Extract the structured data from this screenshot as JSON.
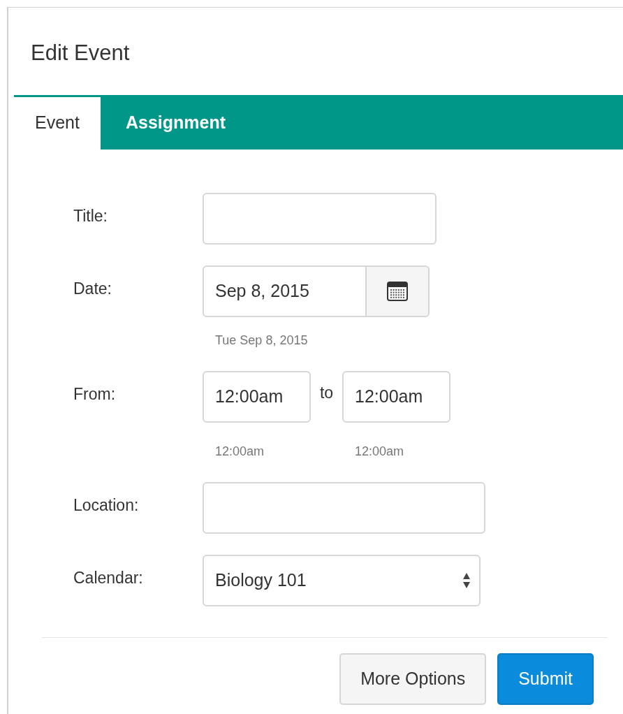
{
  "dialog": {
    "title": "Edit Event"
  },
  "tabs": [
    {
      "label": "Event",
      "selected": true
    },
    {
      "label": "Assignment",
      "selected": false
    }
  ],
  "fields": [
    {
      "kind": "text",
      "label": "Title:"
    },
    {
      "kind": "date",
      "label": "Date:",
      "value": "Sep 8, 2015",
      "hint": "Tue Sep 8, 2015"
    },
    {
      "kind": "timerange",
      "label": "From:",
      "start": {
        "value": "12:00am",
        "hint": "12:00am"
      },
      "separator": "to",
      "end": {
        "value": "12:00am",
        "hint": "12:00am"
      }
    },
    {
      "kind": "text",
      "label": "Location:"
    },
    {
      "kind": "select",
      "label": "Calendar:",
      "value": "Biology 101"
    }
  ],
  "buttons": [
    {
      "label": "More Options",
      "kind": "secondary"
    },
    {
      "label": "Submit",
      "kind": "primary"
    }
  ]
}
